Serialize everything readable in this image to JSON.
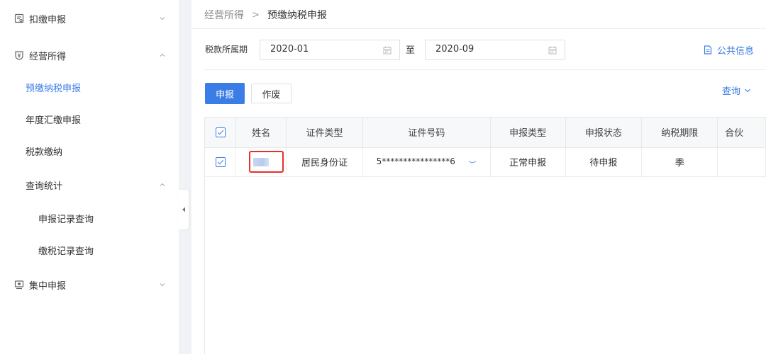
{
  "sidebar": {
    "items": [
      {
        "label": "扣缴申报",
        "icon": "report-icon",
        "expanded": false
      },
      {
        "label": "经营所得",
        "icon": "yuan-shield-icon",
        "expanded": true
      },
      {
        "label": "集中申报",
        "icon": "monitor-icon",
        "expanded": false
      }
    ],
    "sub_items": [
      {
        "label": "预缴纳税申报",
        "active": true
      },
      {
        "label": "年度汇缴申报"
      },
      {
        "label": "税款缴纳"
      },
      {
        "label": "查询统计",
        "expanded": true
      }
    ],
    "nested_items": [
      {
        "label": "申报记录查询"
      },
      {
        "label": "缴税记录查询"
      }
    ]
  },
  "breadcrumb": {
    "parent": "经营所得",
    "separator": ">",
    "current": "预缴纳税申报"
  },
  "filter": {
    "period_label": "税款所属期",
    "start": "2020-01",
    "to_label": "至",
    "end": "2020-09"
  },
  "public_info_label": "公共信息",
  "actions": {
    "declare_label": "申报",
    "void_label": "作废",
    "query_label": "查询"
  },
  "table": {
    "columns": [
      "姓名",
      "证件类型",
      "证件号码",
      "申报类型",
      "申报状态",
      "纳税期限",
      "合伙"
    ],
    "rows": [
      {
        "checked": true,
        "name": "",
        "id_type": "居民身份证",
        "id_number": "5****************6",
        "declare_type": "正常申报",
        "declare_status": "待申报",
        "tax_period": "季"
      }
    ]
  },
  "colors": {
    "accent": "#3a7de6",
    "highlight": "#e7302a"
  }
}
